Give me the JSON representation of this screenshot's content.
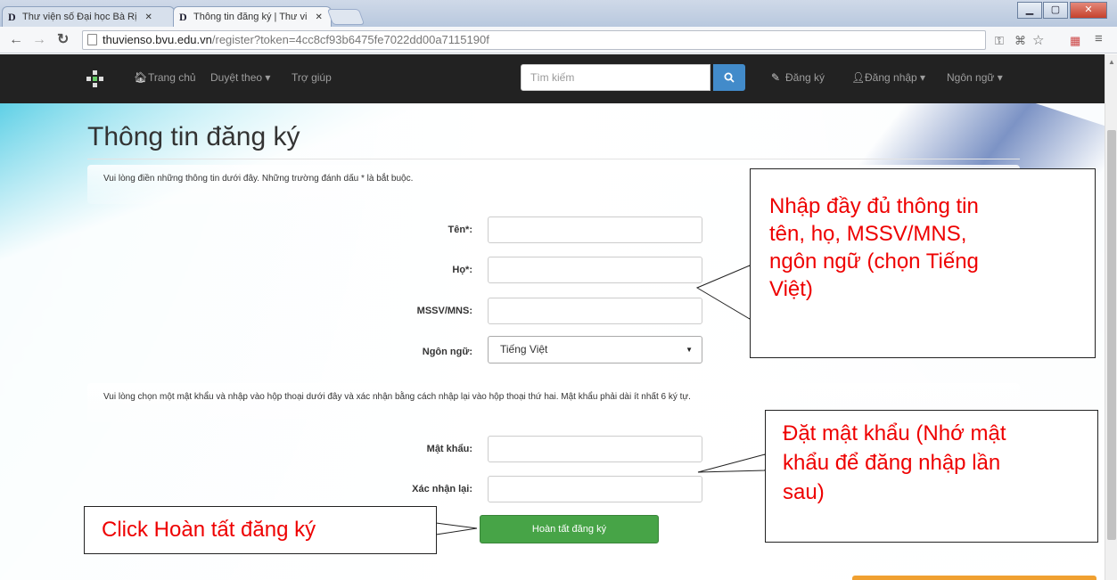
{
  "browser": {
    "tabs": [
      {
        "label": "Thư viện số Đại học Bà Rị",
        "favicon": "D"
      },
      {
        "label": "Thông tin đăng ký | Thư vi",
        "favicon": "D"
      }
    ],
    "url_host": "thuvienso.bvu.edu.vn",
    "url_path": "/register?token=4cc8cf93b6475fe7022dd00a7115190f",
    "window_controls": {
      "min": "▁",
      "max": "▢",
      "close": "✕"
    }
  },
  "navbar": {
    "home": "Trang chủ",
    "browse": "Duyệt theo ▾",
    "help": "Trợ giúp",
    "search_placeholder": "Tìm kiếm",
    "register": "Đăng ký",
    "login": "Đăng nhập ▾",
    "language": "Ngôn ngữ ▾"
  },
  "page": {
    "title": "Thông tin đăng ký",
    "instruction_1": "Vui lòng điền những thông tin dưới đây. Những trường đánh dấu * là bắt buộc.",
    "instruction_2": "Vui lòng chọn một mật khẩu và nhập vào hộp thoại dưới đây và xác nhận bằng cách nhập lại vào hộp thoại thứ hai. Mật khẩu phải dài ít nhất 6 ký tự."
  },
  "form": {
    "first_name_label": "Tên*:",
    "last_name_label": "Họ*:",
    "student_id_label": "MSSV/MNS:",
    "language_label": "Ngôn ngữ:",
    "language_value": "Tiếng Việt",
    "password_label": "Mật khẩu:",
    "confirm_label": "Xác nhận lại:",
    "submit_label": "Hoàn tất đăng ký"
  },
  "callouts": {
    "info": [
      "Nhập đầy đủ thông tin",
      "tên, họ, MSSV/MNS,",
      "ngôn ngữ (chọn Tiếng",
      "Việt)"
    ],
    "password": [
      "Đặt mật khẩu (Nhớ mật",
      "khẩu để đăng nhập lần",
      "sau)"
    ],
    "submit": "Click Hoàn tất đăng ký"
  },
  "colors": {
    "callout_text": "#e00000",
    "submit_button": "#47a447",
    "search_button": "#428bca",
    "navbar_bg": "#222222"
  }
}
